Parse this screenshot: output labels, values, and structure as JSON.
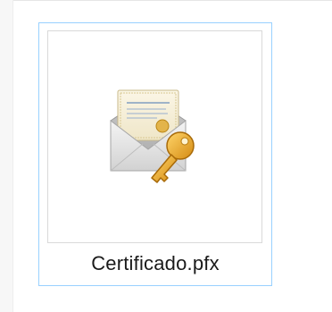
{
  "file": {
    "name": "Certificado.pfx",
    "icon": "certificate-envelope-key-icon"
  },
  "colors": {
    "selection_border": "#99d1ff",
    "thumbnail_border": "#d9d9d9",
    "key_gold": "#e8a431",
    "envelope_gray": "#d6d6d6"
  }
}
